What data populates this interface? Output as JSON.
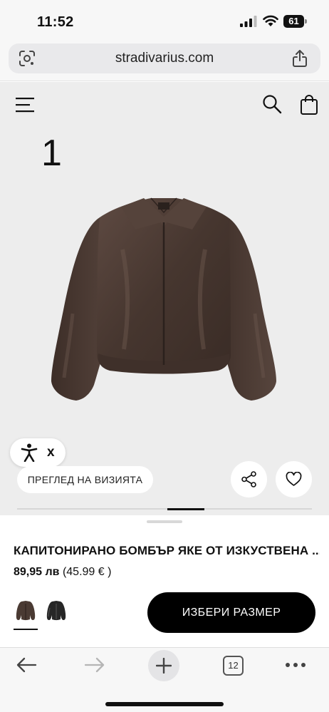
{
  "status_bar": {
    "time": "11:52",
    "battery": "61",
    "icons": [
      "signal-icon",
      "wifi-icon",
      "battery-icon"
    ]
  },
  "browser": {
    "url": "stradivarius.com",
    "tab_count": "12",
    "icons": [
      "google-lens-icon",
      "share-icon",
      "back-arrow-icon",
      "forward-arrow-icon",
      "plus-icon",
      "tabs-icon",
      "more-icon"
    ]
  },
  "header": {
    "icons": [
      "hamburger-menu-icon",
      "search-icon",
      "shopping-bag-icon"
    ]
  },
  "gallery": {
    "image_index": "1",
    "progress_fraction": 0.5
  },
  "accessibility": {
    "close_label": "x"
  },
  "actions": {
    "visit_preview": "ПРЕГЛЕД НА ВИЗИЯТА"
  },
  "product": {
    "title": "КАПИТОНИРАНО БОМБЪР ЯКЕ ОТ ИЗКУСТВЕНА ...",
    "price_main": "89,95 лв",
    "price_alt": "(45.99 € )",
    "select_size": "ИЗБЕРИ РАЗМЕР",
    "colors": [
      {
        "name": "brown",
        "hex": "#4a3a33"
      },
      {
        "name": "black",
        "hex": "#262626"
      }
    ],
    "selected_color_index": 0
  },
  "colors": {
    "accent": "#000000",
    "product_bg": "#ededed",
    "jacket": "#4a3a33"
  }
}
